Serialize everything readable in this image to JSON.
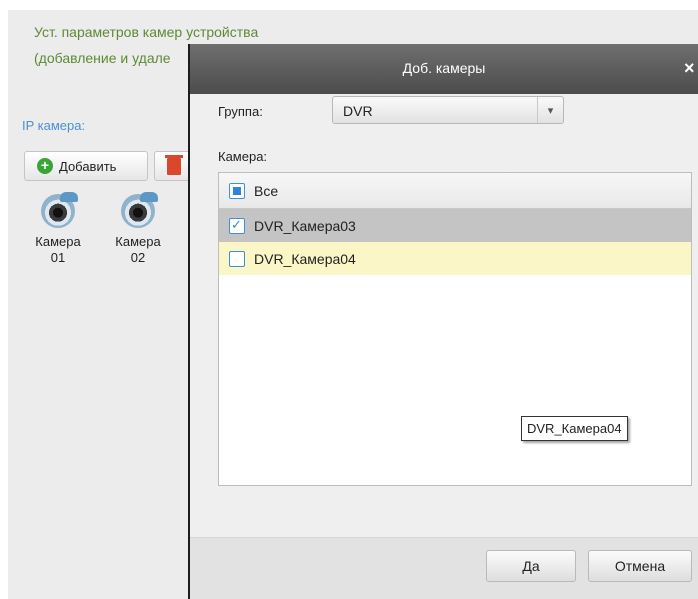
{
  "background": {
    "title_line1": "Уст. параметров камер устройства",
    "title_line2": "(добавление и удале",
    "ip_camera_label": "IP камера:",
    "add_button_label": "Добавить",
    "cameras": [
      {
        "line1": "Камера",
        "line2": "01"
      },
      {
        "line1": "Камера",
        "line2": "02"
      }
    ]
  },
  "dialog": {
    "title": "Доб. камеры",
    "close_label": "×",
    "group_label": "Группа:",
    "group_value": "DVR",
    "camera_label": "Камера:",
    "list": {
      "header": {
        "label": "Все",
        "state": "partial"
      },
      "items": [
        {
          "label": "DVR_Камера03",
          "checked": true
        },
        {
          "label": "DVR_Камера04",
          "checked": false
        }
      ]
    },
    "tooltip": "DVR_Камера04",
    "ok_label": "Да",
    "cancel_label": "Отмена"
  },
  "colors": {
    "accent_blue": "#2f86d8",
    "title_green": "#5d8a32",
    "hover_row": "#fbf6c6",
    "selected_row": "#c4c4c4",
    "dialog_header": "#5a5a5a"
  },
  "icons": [
    "plus-icon",
    "trash-icon",
    "camera-icon",
    "close-icon",
    "chevron-down-icon",
    "checkbox-icon"
  ]
}
